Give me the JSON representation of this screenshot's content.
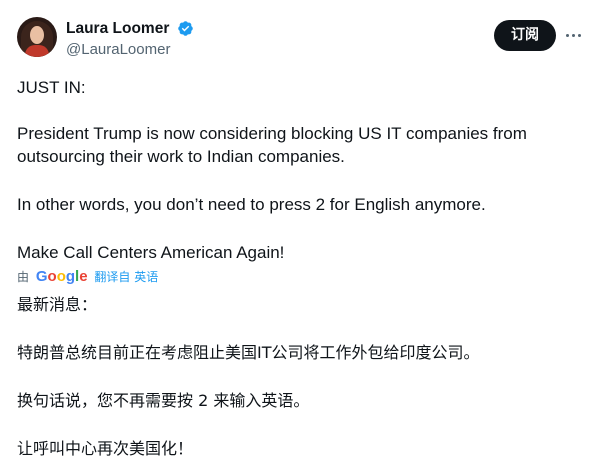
{
  "author": {
    "display_name": "Laura Loomer",
    "handle": "@LauraLoomer",
    "verified": true,
    "verified_color": "#1d9bf0"
  },
  "actions": {
    "subscribe_label": "订阅",
    "more_icon": "more-horizontal-icon"
  },
  "tweet": {
    "original": [
      "JUST IN:",
      "President Trump is now considering blocking US IT companies from",
      "outsourcing their work to Indian companies.",
      "In other words, you don’t need to press 2 for English anymore.",
      "Make Call Centers American Again!"
    ],
    "translation_by": "由",
    "translation_provider": "Google",
    "translation_link": "翻译自 英语",
    "translated": [
      "最新消息：",
      "特朗普总统目前正在考虑阻止美国IT公司将工作外包给印度公司。",
      "换句话说，您不再需要按 2 来输入英语。",
      "让呼叫中心再次美国化！"
    ]
  },
  "colors": {
    "text": "#0f1419",
    "secondary": "#536471",
    "link": "#1d9bf0",
    "button_bg": "#0f1419"
  }
}
